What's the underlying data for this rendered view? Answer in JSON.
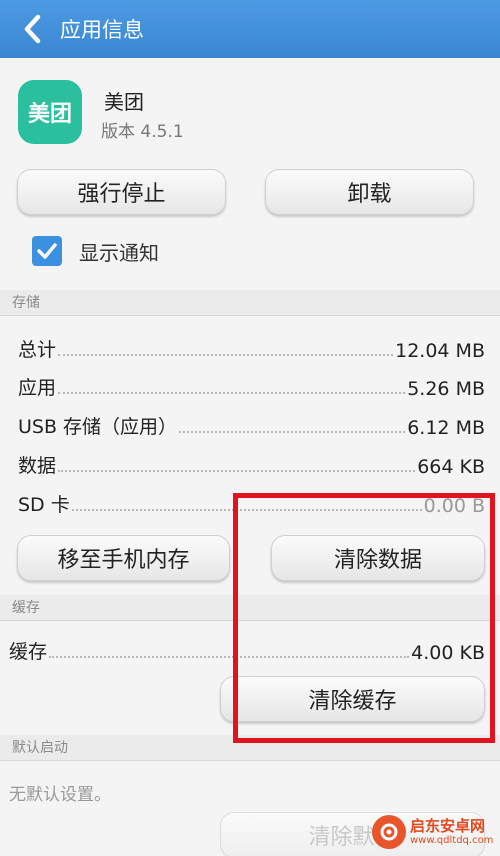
{
  "header": {
    "title": "应用信息"
  },
  "app": {
    "icon_text": "美团",
    "name": "美团",
    "version": "版本 4.5.1"
  },
  "actions": {
    "force_stop": "强行停止",
    "uninstall": "卸载"
  },
  "notification": {
    "label": "显示通知",
    "checked": true
  },
  "storage": {
    "section_title": "存储",
    "rows": [
      {
        "label": "总计",
        "value": "12.04 MB"
      },
      {
        "label": "应用",
        "value": "5.26 MB"
      },
      {
        "label": "USB 存储（应用）",
        "value": "6.12 MB"
      },
      {
        "label": "数据",
        "value": "664 KB"
      },
      {
        "label": "SD 卡",
        "value": "0.00 B"
      }
    ],
    "move_button": "移至手机内存",
    "clear_data_button": "清除数据"
  },
  "cache": {
    "section_title": "缓存",
    "label": "缓存",
    "value": "4.00 KB",
    "clear_cache_button": "清除缓存"
  },
  "default_launch": {
    "section_title": "默认启动",
    "status": "无默认设置。",
    "clear_defaults_button": "清除默认"
  },
  "watermark": {
    "title": "启东安卓网",
    "url": "www.qdltdq.com"
  },
  "colors": {
    "titlebar": "#3a86d2",
    "checkbox": "#3b91e0",
    "app_icon": "#2bbf9d",
    "highlight": "#e0141e"
  }
}
